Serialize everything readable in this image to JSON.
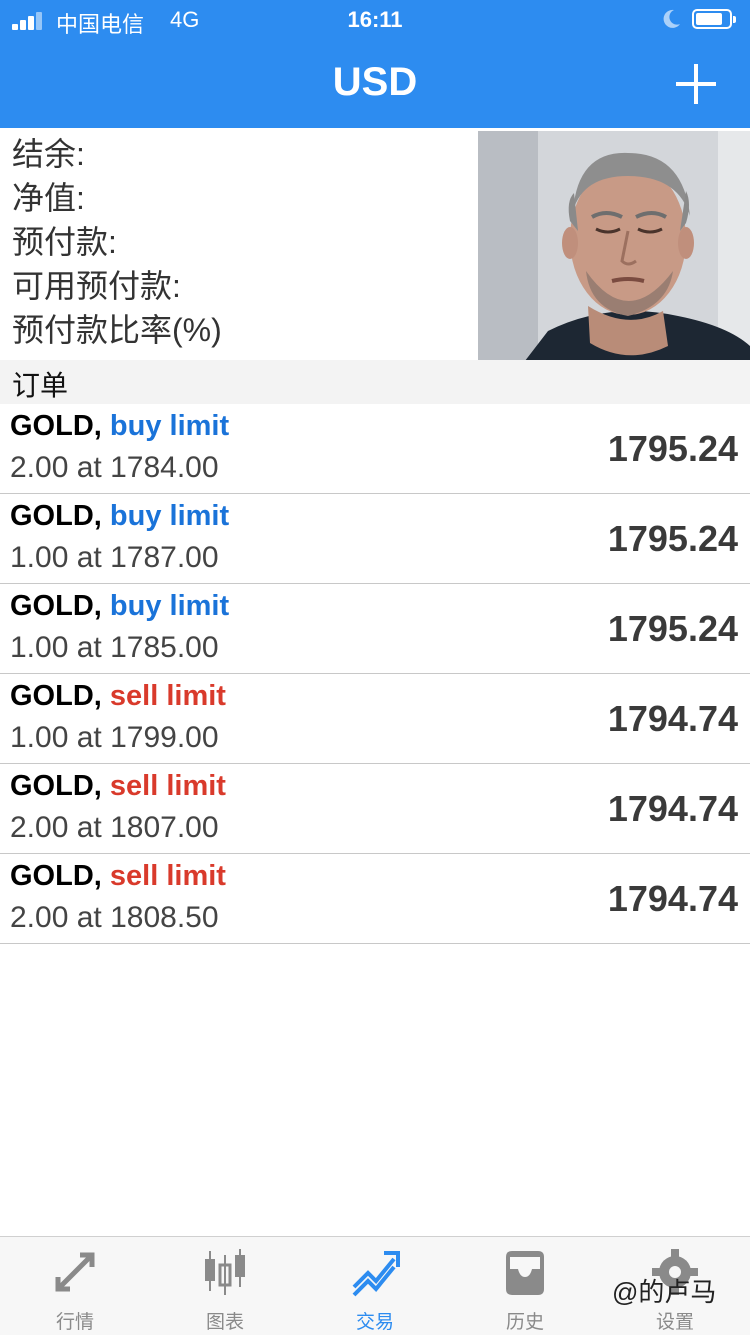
{
  "status_bar": {
    "carrier": "中国电信",
    "network": "4G",
    "time": "16:11"
  },
  "header": {
    "title": "USD"
  },
  "account": {
    "balance_label": "结余:",
    "equity_label": "净值:",
    "margin_label": "预付款:",
    "free_margin_label": "可用预付款:",
    "margin_level_label": "预付款比率(%)"
  },
  "orders_section": {
    "title": "订单",
    "items": [
      {
        "symbol": "GOLD",
        "type": "buy limit",
        "kind": "buy",
        "detail": "2.00 at 1784.00",
        "price": "1795.24"
      },
      {
        "symbol": "GOLD",
        "type": "buy limit",
        "kind": "buy",
        "detail": "1.00 at 1787.00",
        "price": "1795.24"
      },
      {
        "symbol": "GOLD",
        "type": "buy limit",
        "kind": "buy",
        "detail": "1.00 at 1785.00",
        "price": "1795.24"
      },
      {
        "symbol": "GOLD",
        "type": "sell limit",
        "kind": "sell",
        "detail": "1.00 at 1799.00",
        "price": "1794.74"
      },
      {
        "symbol": "GOLD",
        "type": "sell limit",
        "kind": "sell",
        "detail": "2.00 at 1807.00",
        "price": "1794.74"
      },
      {
        "symbol": "GOLD",
        "type": "sell limit",
        "kind": "sell",
        "detail": "2.00 at 1808.50",
        "price": "1794.74"
      }
    ]
  },
  "tabbar": {
    "quotes": "行情",
    "chart": "图表",
    "trade": "交易",
    "history": "历史",
    "settings": "设置",
    "active": "trade"
  },
  "watermark": "@的卢马",
  "colors": {
    "accent": "#2d8cf0",
    "buy": "#1a73d9",
    "sell": "#d93a2b"
  }
}
